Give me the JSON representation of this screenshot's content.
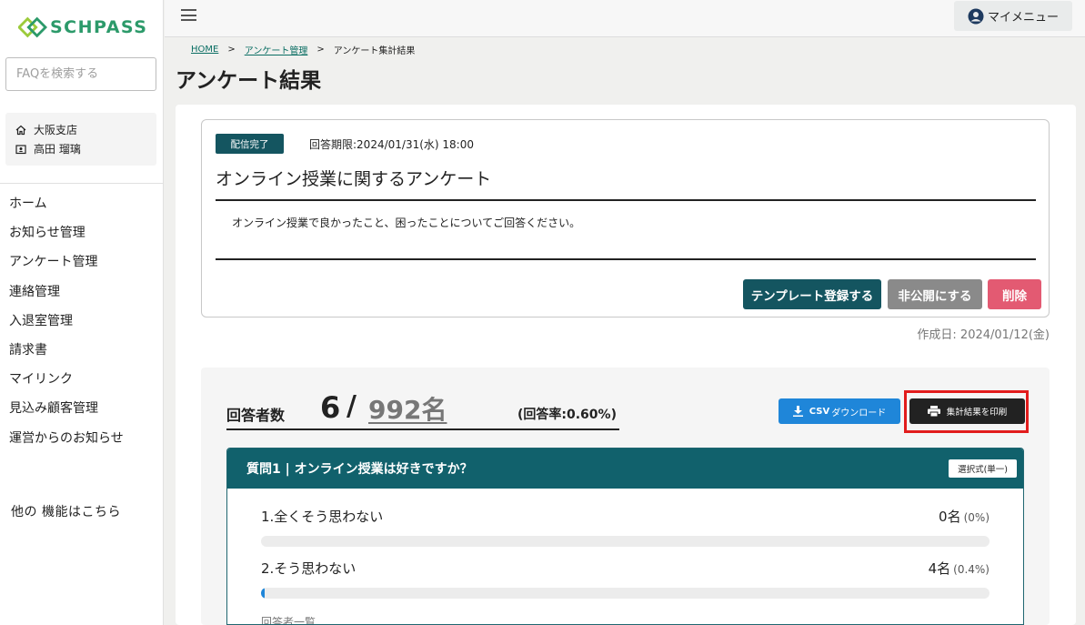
{
  "app": {
    "logo_text": "SCHPASS",
    "accent": "#145560",
    "brand_green": "#2c9a6a"
  },
  "sidebar": {
    "search_placeholder": "FAQを検索する",
    "branch": "大阪支店",
    "user": "高田 瑠璃",
    "items": [
      {
        "label": "ホーム"
      },
      {
        "label": "お知らせ管理"
      },
      {
        "label": "アンケート管理"
      },
      {
        "label": "連絡管理"
      },
      {
        "label": "入退室管理"
      },
      {
        "label": "請求書"
      },
      {
        "label": "マイリンク"
      },
      {
        "label": "見込み顧客管理"
      },
      {
        "label": "運営からのお知らせ"
      }
    ],
    "other_functions": "他の 機能はこちら"
  },
  "header": {
    "my_menu": "マイメニュー"
  },
  "breadcrumb": {
    "home": "HOME",
    "survey_mgmt": "アンケート管理",
    "current": "アンケート集計結果",
    "sep": ">"
  },
  "page_title": "アンケート結果",
  "survey": {
    "status": "配信完了",
    "deadline_label": "回答期限:",
    "deadline_value": "2024/01/31(水) 18:00",
    "title": "オンライン授業に関するアンケート",
    "description": "オンライン授業で良かったこと、困ったことについてご回答ください。",
    "buttons": {
      "template": "テンプレート登録する",
      "unpublish": "非公開にする",
      "delete": "削除"
    },
    "created": "作成日: 2024/01/12(金)"
  },
  "results": {
    "respondents_label": "回答者数",
    "count": "6",
    "slash": "/",
    "total": "992名",
    "rate": "(回答率:0.60%)",
    "csv_bold": "CSV",
    "csv_rest": "ダウンロード",
    "print_label": "集計結果を印刷",
    "question": {
      "header": "質問1 | オンライン授業は好きですか？",
      "type": "選択式(単一)",
      "options": [
        {
          "label": "1.全くそう思わない",
          "count": "0名",
          "pct": "(0%)",
          "fill_percent": 0
        },
        {
          "label": "2.そう思わない",
          "count": "4名",
          "pct": "(0.4%)",
          "fill_percent": 0.4
        }
      ],
      "respondent_list": "回答者一覧"
    }
  }
}
